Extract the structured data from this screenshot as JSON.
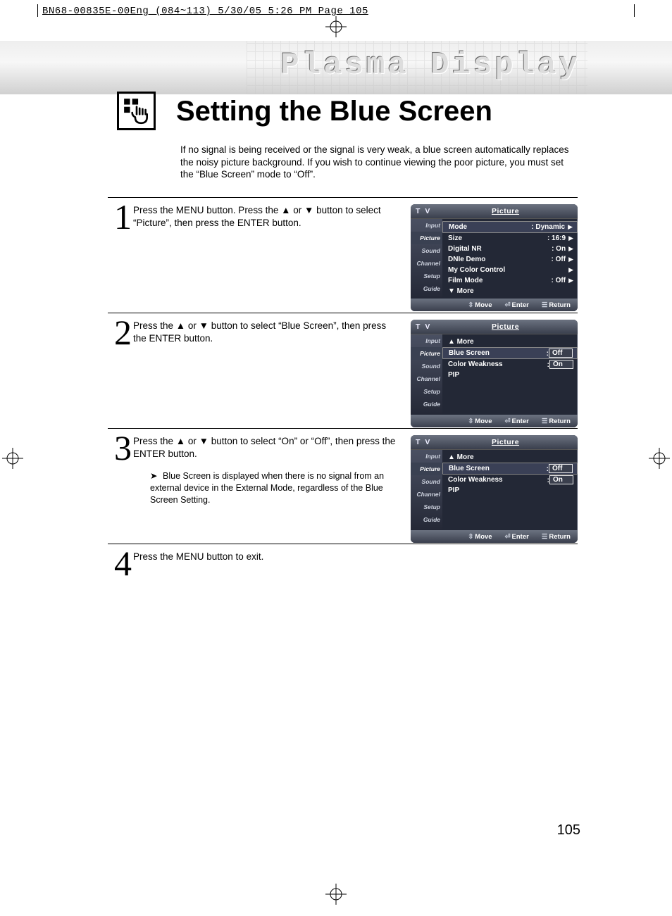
{
  "slug": "BN68-00835E-00Eng_(084~113)  5/30/05  5:26 PM  Page 105",
  "banner": "Plasma Display",
  "title": "Setting the Blue Screen",
  "intro": "If no signal is being received or the signal is very weak, a blue screen automatically replaces the noisy picture background. If you wish to continue viewing the poor picture, you must set the “Blue Screen” mode to “Off”.",
  "steps": {
    "s1": {
      "num": "1",
      "text": "Press the MENU button. Press the ▲ or ▼ button to select “Picture”, then press the ENTER button."
    },
    "s2": {
      "num": "2",
      "text": "Press the ▲ or ▼ button to select “Blue Screen”, then press the ENTER button."
    },
    "s3": {
      "num": "3",
      "text": "Press the ▲ or ▼ button to select “On” or “Off”, then press the ENTER button.",
      "note": "Blue Screen is displayed when there is no signal from an external device in the External Mode, regardless of the Blue Screen Setting."
    },
    "s4": {
      "num": "4",
      "text": "Press the MENU button to exit."
    }
  },
  "osd": {
    "tv": "T V",
    "title": "Picture",
    "side": [
      "Input",
      "Picture",
      "Sound",
      "Channel",
      "Setup",
      "Guide"
    ],
    "foot": {
      "move": "Move",
      "enter": "Enter",
      "return": "Return"
    },
    "menu1": {
      "rows": [
        {
          "label": "Mode",
          "val": ": Dynamic",
          "caret": "▶",
          "sel": true
        },
        {
          "label": "Size",
          "val": ": 16:9",
          "caret": "▶"
        },
        {
          "label": "Digital NR",
          "val": ": On",
          "caret": "▶"
        },
        {
          "label": "DNIe Demo",
          "val": ": Off",
          "caret": "▶"
        },
        {
          "label": "My Color Control",
          "val": "",
          "caret": "▶"
        },
        {
          "label": "Film Mode",
          "val": ": Off",
          "caret": "▶"
        },
        {
          "label": "▼ More",
          "val": "",
          "caret": ""
        }
      ]
    },
    "menu2": {
      "rows": [
        {
          "label": "▲ More",
          "val": "",
          "box": false
        },
        {
          "label": "Blue Screen",
          "val": "Off",
          "pre": ": ",
          "box": true,
          "sel": true
        },
        {
          "label": "Color Weakness",
          "val": "On",
          "pre": ": ",
          "box": true
        },
        {
          "label": "PIP",
          "val": "",
          "box": false
        }
      ]
    },
    "menu3": {
      "rows": [
        {
          "label": "▲ More",
          "val": "",
          "box": false
        },
        {
          "label": "Blue Screen",
          "val": "Off",
          "pre": ": ",
          "box": true,
          "sel": true
        },
        {
          "label": "Color Weakness",
          "val": "On",
          "pre": ": ",
          "box": true
        },
        {
          "label": "PIP",
          "val": "",
          "box": false
        }
      ]
    }
  },
  "pagenum": "105"
}
